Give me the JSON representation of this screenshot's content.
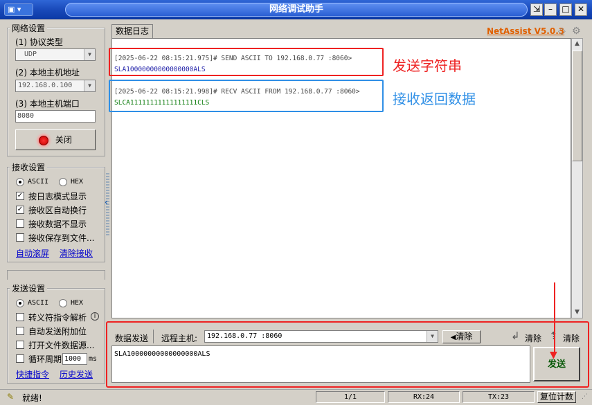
{
  "window": {
    "title": "网络调试助手",
    "brand": "NetAssist V5.0.3"
  },
  "network_settings": {
    "title": "网络设置",
    "protocol_label": "(1) 协议类型",
    "protocol_value": "UDP",
    "host_label": "(2) 本地主机地址",
    "host_value": "192.168.0.100",
    "port_label": "(3) 本地主机端口",
    "port_value": "8080",
    "toggle_label": "关闭"
  },
  "receive_settings": {
    "title": "接收设置",
    "ascii_label": "ASCII",
    "hex_label": "HEX",
    "encoding_selected": "ASCII",
    "options": [
      {
        "label": "按日志模式显示",
        "checked": true
      },
      {
        "label": "接收区自动换行",
        "checked": true
      },
      {
        "label": "接收数据不显示",
        "checked": false
      },
      {
        "label": "接收保存到文件...",
        "checked": false
      }
    ],
    "link_autoscroll": "自动滚屏",
    "link_clear": "清除接收"
  },
  "send_settings": {
    "title": "发送设置",
    "ascii_label": "ASCII",
    "hex_label": "HEX",
    "encoding_selected": "ASCII",
    "options": [
      {
        "label": "转义符指令解析",
        "checked": false
      },
      {
        "label": "自动发送附加位",
        "checked": false
      },
      {
        "label": "打开文件数据源...",
        "checked": false
      },
      {
        "label": "循环周期",
        "checked": false
      }
    ],
    "cycle_value": "1000",
    "cycle_unit": "ms",
    "link_shortcut": "快捷指令",
    "link_history": "历史发送"
  },
  "log": {
    "tab": "数据日志",
    "entries": [
      {
        "header": "[2025-06-22 08:15:21.975]# SEND ASCII TO 192.168.0.77 :8060>",
        "data": "SLA10000000000000000ALS",
        "color": "#1a1aa6"
      },
      {
        "header": "[2025-06-22 08:15:21.998]# RECV ASCII FROM 192.168.0.77 :8060>",
        "data": "SLCA11111111111111111CLS",
        "color": "#0a7a0a"
      }
    ],
    "annotations": [
      {
        "text": "发送字符串",
        "color": "#ee2222"
      },
      {
        "text": "接收返回数据",
        "color": "#2f8fe6"
      }
    ]
  },
  "send_bar": {
    "tab": "数据发送",
    "remote_label": "远程主机:",
    "remote_value": "192.168.0.77 :8060",
    "clear_label": "清除",
    "clear2_label": "清除",
    "clear3_label": "清除",
    "input_value": "SLA10000000000000000ALS",
    "send_label": "发送"
  },
  "status_bar": {
    "ready": "就绪!",
    "frames": "1/1",
    "rx": "RX:24",
    "tx": "TX:23",
    "reset": "复位计数"
  },
  "colors": {
    "highlight_red": "#ee2222",
    "highlight_blue": "#2f8fe6",
    "title_bar": "#1848b8"
  }
}
